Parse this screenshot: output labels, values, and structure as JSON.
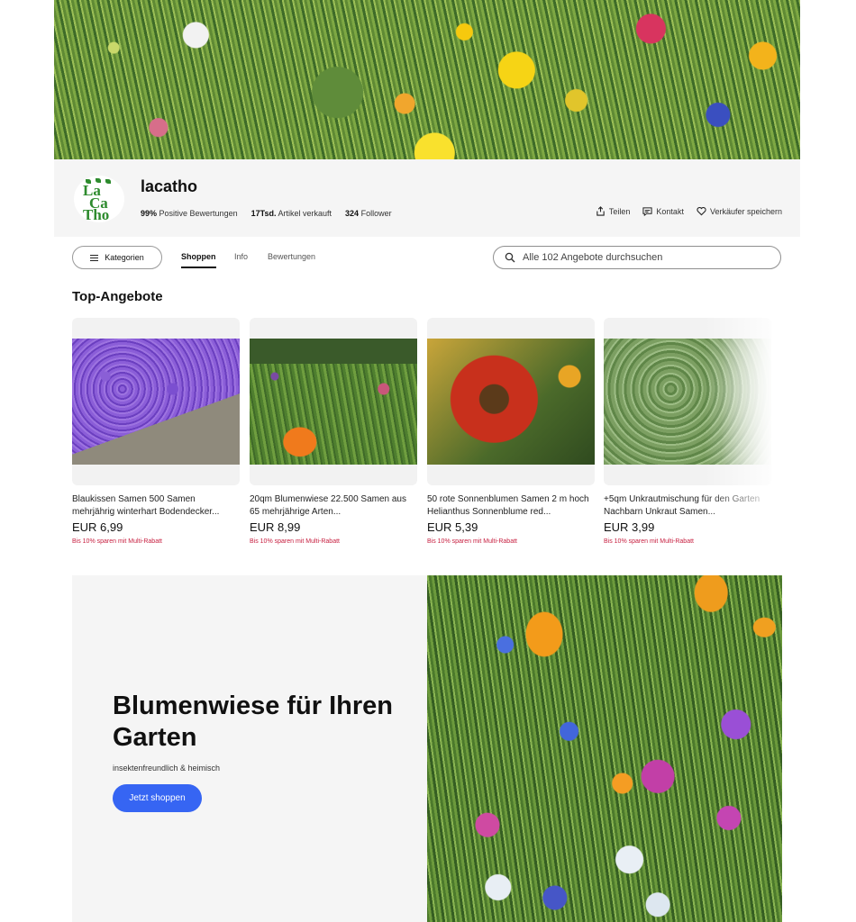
{
  "store": {
    "name": "lacatho",
    "logo_text": [
      "La",
      "Ca",
      "Tho"
    ],
    "stats": {
      "positive_value": "99%",
      "positive_label": "Positive Bewertungen",
      "sold_value": "17Tsd.",
      "sold_label": "Artikel verkauft",
      "follower_value": "324",
      "follower_label": "Follower"
    },
    "actions": {
      "share": "Teilen",
      "contact": "Kontakt",
      "save": "Verkäufer speichern"
    }
  },
  "nav": {
    "categories_label": "Kategorien",
    "tabs": [
      {
        "label": "Shoppen",
        "active": true
      },
      {
        "label": "Info",
        "active": false
      },
      {
        "label": "Bewertungen",
        "active": false
      }
    ],
    "search_placeholder": "Alle 102 Angebote durchsuchen"
  },
  "top_offers": {
    "title": "Top-Angebote",
    "items": [
      {
        "title": "Blaukissen Samen 500 Samen mehrjährig winterhart Bodendecker...",
        "price": "EUR 6,99",
        "promo": "Bis 10% sparen mit Multi-Rabatt"
      },
      {
        "title": "20qm Blumenwiese 22.500 Samen aus 65 mehrjährige Arten...",
        "price": "EUR 8,99",
        "promo": "Bis 10% sparen mit Multi-Rabatt"
      },
      {
        "title": "50 rote Sonnenblumen Samen 2 m hoch Helianthus Sonnenblume red...",
        "price": "EUR 5,39",
        "promo": "Bis 10% sparen mit Multi-Rabatt"
      },
      {
        "title": "+5qm Unkrautmischung für den Garten Nachbarn Unkraut Samen...",
        "price": "EUR 3,99",
        "promo": "Bis 10% sparen mit Multi-Rabatt"
      }
    ]
  },
  "promo": {
    "title": "Blumenwiese für Ihren Garten",
    "subtitle": "insektenfreundlich & heimisch",
    "button": "Jetzt shoppen"
  },
  "colors": {
    "accent": "#3665f3",
    "promo_text": "#c71e3f",
    "header_bg": "#f5f5f5",
    "logo_green": "#2e8b2e"
  }
}
